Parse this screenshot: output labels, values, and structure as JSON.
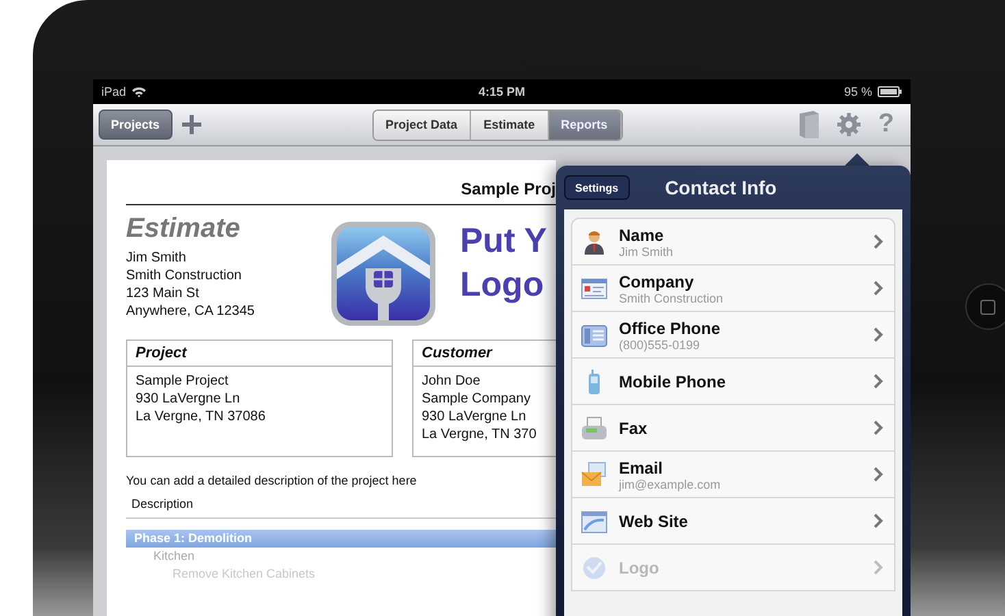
{
  "status_bar": {
    "device": "iPad",
    "time": "4:15 PM",
    "battery": "95 %"
  },
  "toolbar": {
    "projects_button": "Projects",
    "help": "?",
    "tabs": [
      {
        "label": "Project Data",
        "selected": false
      },
      {
        "label": "Estimate",
        "selected": false
      },
      {
        "label": "Reports",
        "selected": true
      }
    ]
  },
  "document": {
    "title": "Sample Proj",
    "heading": "Estimate",
    "contractor_lines": [
      "Jim Smith",
      "Smith Construction",
      "123 Main St",
      "Anywhere, CA 12345"
    ],
    "logo_placeholder_lines": [
      "Put Y",
      "Logo"
    ],
    "project_box": {
      "heading": "Project",
      "lines": [
        "Sample Project",
        "930 LaVergne Ln",
        "La Vergne, TN 37086"
      ]
    },
    "customer_box": {
      "heading": "Customer",
      "lines": [
        "John Doe",
        "Sample Company",
        "930 LaVergne Ln",
        "La Vergne, TN 370"
      ]
    },
    "description_hint": "You can add a detailed description of the project here",
    "description_label": "Description",
    "phases": [
      {
        "name": "Phase 1: Demolition",
        "selected": true,
        "children": [
          {
            "name": "Kitchen",
            "selected": false,
            "children": [
              {
                "name": "Remove Kitchen Cabinets",
                "selected": false
              }
            ]
          }
        ]
      }
    ]
  },
  "popover": {
    "back_button": "Settings",
    "title": "Contact Info",
    "rows": [
      {
        "kind": "person",
        "label": "Name",
        "value": "Jim Smith",
        "disabled": false
      },
      {
        "kind": "card",
        "label": "Company",
        "value": "Smith Construction",
        "disabled": false
      },
      {
        "kind": "phone",
        "label": "Office Phone",
        "value": "(800)555-0199",
        "disabled": false
      },
      {
        "kind": "mobile",
        "label": "Mobile Phone",
        "disabled": false
      },
      {
        "kind": "fax",
        "label": "Fax",
        "disabled": false
      },
      {
        "kind": "email",
        "label": "Email",
        "value": "jim@example.com",
        "disabled": false
      },
      {
        "kind": "web",
        "label": "Web Site",
        "disabled": false
      },
      {
        "kind": "logo",
        "label": "Logo",
        "disabled": true
      }
    ]
  }
}
